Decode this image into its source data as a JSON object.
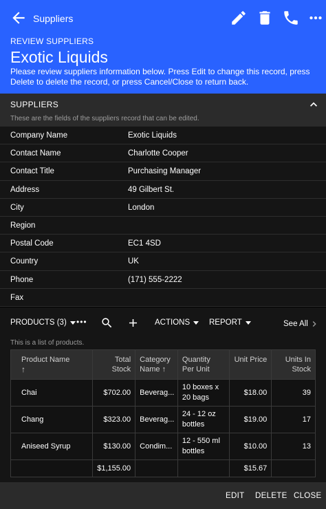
{
  "header": {
    "back_title": "Suppliers",
    "review_label": "REVIEW SUPPLIERS",
    "record_title": "Exotic Liquids",
    "instructions": "Please review suppliers information below. Press Edit to change this record, press Delete to delete the record, or press Cancel/Close to return back.",
    "actions": [
      "pencil-icon",
      "trash-icon",
      "phone-icon",
      "more-icon"
    ],
    "accent_color": "#2962ff"
  },
  "suppliers_section": {
    "title": "SUPPLIERS",
    "description": "These are the fields of the suppliers record that can be edited.",
    "fields": [
      {
        "label": "Company Name",
        "value": "Exotic Liquids"
      },
      {
        "label": "Contact Name",
        "value": "Charlotte Cooper"
      },
      {
        "label": "Contact Title",
        "value": "Purchasing Manager"
      },
      {
        "label": "Address",
        "value": "49 Gilbert St."
      },
      {
        "label": "City",
        "value": "London"
      },
      {
        "label": "Region",
        "value": ""
      },
      {
        "label": "Postal Code",
        "value": "EC1 4SD"
      },
      {
        "label": "Country",
        "value": "UK"
      },
      {
        "label": "Phone",
        "value": "(171) 555-2222"
      },
      {
        "label": "Fax",
        "value": ""
      }
    ]
  },
  "products": {
    "title": "PRODUCTS (3)",
    "more": "•••",
    "actions_label": "ACTIONS",
    "report_label": "REPORT",
    "see_all": "See All",
    "description": "This is a list of products.",
    "columns": [
      {
        "top": "Product Name",
        "bottom": "↑"
      },
      {
        "top": "Total",
        "bottom": "Stock"
      },
      {
        "top": "Category",
        "bottom": "Name ↑"
      },
      {
        "top": "Quantity",
        "bottom": "Per Unit"
      },
      {
        "top": "Unit Price",
        "bottom": ""
      },
      {
        "top": "Units In",
        "bottom": "Stock"
      }
    ],
    "rows": [
      {
        "name": "Chai",
        "total": "$702.00",
        "category": "Beverag...",
        "qty": "10 boxes x 20 bags",
        "price": "$18.00",
        "stock": "39"
      },
      {
        "name": "Chang",
        "total": "$323.00",
        "category": "Beverag...",
        "qty": "24 - 12 oz bottles",
        "price": "$19.00",
        "stock": "17"
      },
      {
        "name": "Aniseed Syrup",
        "total": "$130.00",
        "category": "Condim...",
        "qty": "12 - 550 ml bottles",
        "price": "$10.00",
        "stock": "13"
      }
    ],
    "totals": {
      "total": "$1,155.00",
      "price": "$15.67"
    }
  },
  "footer": {
    "edit": "EDIT",
    "delete": "DELETE",
    "close": "CLOSE"
  }
}
